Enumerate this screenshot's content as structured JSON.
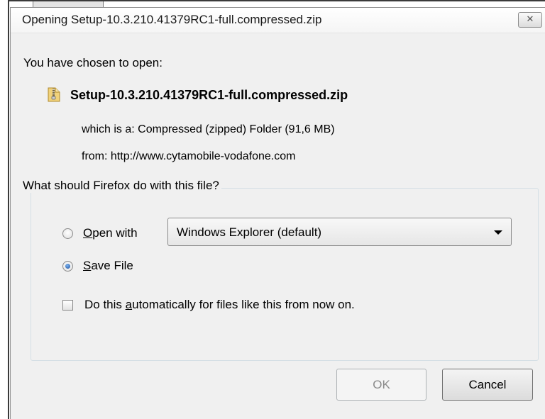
{
  "dialog": {
    "title": "Opening Setup-10.3.210.41379RC1-full.compressed.zip",
    "close_icon": "close-icon",
    "prompt": "You have chosen to open:",
    "file": {
      "icon": "zip-folder-icon",
      "name": "Setup-10.3.210.41379RC1-full.compressed.zip",
      "type_label": "which is a:",
      "type_value": "Compressed (zipped) Folder (91,6 MB)",
      "from_label": "from:",
      "from_value": "http://www.cytamobile-vodafone.com"
    },
    "action_group": {
      "legend": "What should Firefox do with this file?",
      "open_with": {
        "accel": "O",
        "rest": "pen with",
        "selected": false,
        "application": "Windows Explorer (default)"
      },
      "save_file": {
        "accel": "S",
        "rest": "ave File",
        "selected": true
      },
      "auto": {
        "pre": "Do this ",
        "accel": "a",
        "post": "utomatically for files like this from now on.",
        "checked": false
      }
    },
    "buttons": {
      "ok": "OK",
      "ok_enabled": false,
      "cancel": "Cancel"
    }
  }
}
